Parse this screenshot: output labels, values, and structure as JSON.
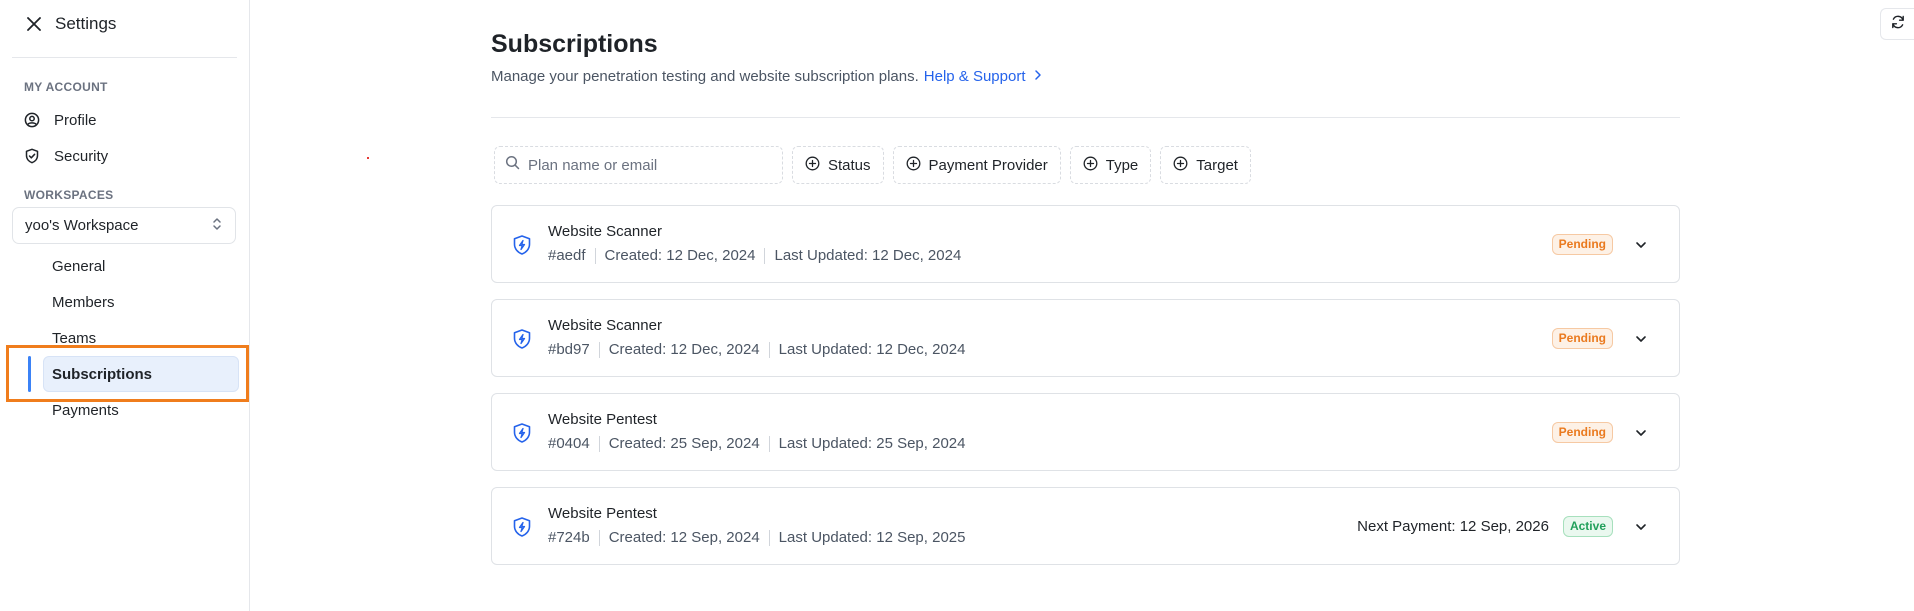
{
  "sidebar": {
    "title": "Settings",
    "sections": {
      "account": "MY ACCOUNT",
      "workspaces": "WORKSPACES"
    },
    "account_items": [
      {
        "label": "Profile",
        "icon": "user-circle-icon"
      },
      {
        "label": "Security",
        "icon": "shield-check-icon"
      }
    ],
    "workspace_select": "yoo's Workspace",
    "workspace_items": [
      "General",
      "Members",
      "Teams",
      "Subscriptions",
      "Payments"
    ],
    "active_item": "Subscriptions"
  },
  "main": {
    "title": "Subscriptions",
    "subtitle": "Manage your penetration testing and website subscription plans.",
    "help_link": "Help & Support",
    "search_placeholder": "Plan name or email",
    "filters": [
      "Status",
      "Payment Provider",
      "Type",
      "Target"
    ],
    "subscriptions": [
      {
        "name": "Website Scanner",
        "id": "#aedf",
        "created": "Created: 12 Dec, 2024",
        "updated": "Last Updated: 12 Dec, 2024",
        "status": "Pending",
        "next_payment": ""
      },
      {
        "name": "Website Scanner",
        "id": "#bd97",
        "created": "Created: 12 Dec, 2024",
        "updated": "Last Updated: 12 Dec, 2024",
        "status": "Pending",
        "next_payment": ""
      },
      {
        "name": "Website Pentest",
        "id": "#0404",
        "created": "Created: 25 Sep, 2024",
        "updated": "Last Updated: 25 Sep, 2024",
        "status": "Pending",
        "next_payment": ""
      },
      {
        "name": "Website Pentest",
        "id": "#724b",
        "created": "Created: 12 Sep, 2024",
        "updated": "Last Updated: 12 Sep, 2025",
        "status": "Active",
        "next_payment": "Next Payment: 12 Sep, 2026"
      }
    ]
  },
  "colors": {
    "accent": "#2563eb",
    "highlight_outline": "#f07d1c",
    "pending": "#ea7a1f",
    "active": "#22a05b"
  }
}
